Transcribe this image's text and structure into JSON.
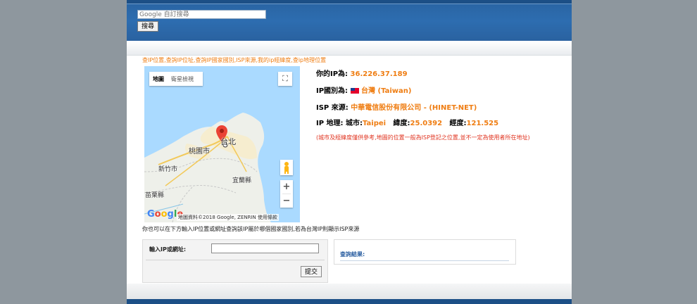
{
  "search": {
    "placeholder": "Google 自訂搜尋",
    "button_label": "搜尋"
  },
  "subtitle": "查IP位置,查詢IP位址,查詢IP國家國別,ISP來源,我的ip經緯度,查ip地理位置",
  "map": {
    "type_map": "地圖",
    "type_satellite": "衛星檢視",
    "fullscreen_glyph": "⛶",
    "zoom_in": "+",
    "zoom_out": "−",
    "labels": {
      "taipei": "台北",
      "taoyuan": "桃園市",
      "hsinchu": "新竹市",
      "yilan": "宜蘭縣",
      "miaoli": "苗栗縣"
    },
    "attribution": "地圖資料©2018 Google, ZENRIN   使用條款",
    "logo": "Google"
  },
  "info": {
    "ip_label": "你的IP為:",
    "ip_value": "36.226.37.189",
    "country_label": "IP國別為:",
    "country_value": "台灣 (Taiwan)",
    "isp_label": "ISP 來源:",
    "isp_value": "中華電信股份有限公司 - (HINET-NET)",
    "geo_label": "IP 地理:",
    "city_label": "城市:",
    "city_value": "Taipei",
    "lat_label": "緯度:",
    "lat_value": "25.0392",
    "lng_label": "經度:",
    "lng_value": "121.525",
    "note": "(城市及經緯度僅供參考,地圖的位置一般為ISP登記之位置,並不一定為使用者所在地址)"
  },
  "description": "你也可以在下方輸入IP位置或網址查詢該IP屬於哪個國家國別,若為台灣IP則顯示ISP來源",
  "lookup": {
    "label": "輸入IP或網址:",
    "input_value": "",
    "submit_label": "提交"
  },
  "result": {
    "label": "查詢結果:"
  },
  "colors": {
    "accent": "#ef7d12",
    "header_blue": "#2d6db0",
    "note_red": "#e0331f",
    "page_bg": "#8e979e"
  }
}
